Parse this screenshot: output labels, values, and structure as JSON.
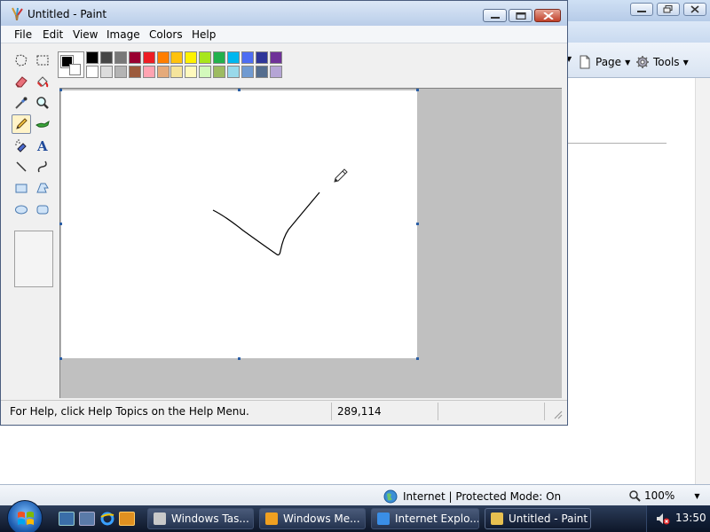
{
  "paint": {
    "title": "Untitled - Paint",
    "menu": [
      "File",
      "Edit",
      "View",
      "Image",
      "Colors",
      "Help"
    ],
    "palette_top": [
      "#000000",
      "#464646",
      "#787878",
      "#990030",
      "#ed1c24",
      "#ff7e00",
      "#ffc20e",
      "#fff200",
      "#a8e61d",
      "#22b14c",
      "#00b7ef",
      "#4d6df3",
      "#2f3699",
      "#6f3198"
    ],
    "palette_bottom": [
      "#ffffff",
      "#dcdcdc",
      "#b4b4b4",
      "#9c5a3c",
      "#ffa3b1",
      "#e5aa7a",
      "#f5e49c",
      "#fff9bd",
      "#d3f9bc",
      "#9dbb61",
      "#99d9ea",
      "#709ad1",
      "#546d8e",
      "#b5a5d5"
    ],
    "foreground_color": "#000000",
    "background_color": "#ffffff",
    "tools": [
      "free-form-select",
      "select",
      "eraser",
      "fill-with-color",
      "pick-color",
      "magnifier",
      "pencil",
      "brush",
      "airbrush",
      "text",
      "line",
      "curve",
      "rectangle",
      "polygon",
      "ellipse",
      "rounded-rectangle"
    ],
    "selected_tool": "pencil",
    "status_help": "For Help, click Help Topics on the Help Menu.",
    "status_coords": "289,114"
  },
  "browser": {
    "cmd_page": "Page",
    "cmd_tools": "Tools",
    "status_zone": "Internet | Protected Mode: On",
    "zoom": "100%"
  },
  "taskbar": {
    "buttons": [
      {
        "label": "Windows Tas...",
        "active": false,
        "color": "#c9c9c9"
      },
      {
        "label": "Windows Me...",
        "active": false,
        "color": "#f0a020"
      },
      {
        "label": "Internet Explo...",
        "active": false,
        "color": "#3a8ee6"
      },
      {
        "label": "Untitled - Paint",
        "active": true,
        "color": "#e8c050"
      }
    ],
    "clock": "13:50"
  }
}
